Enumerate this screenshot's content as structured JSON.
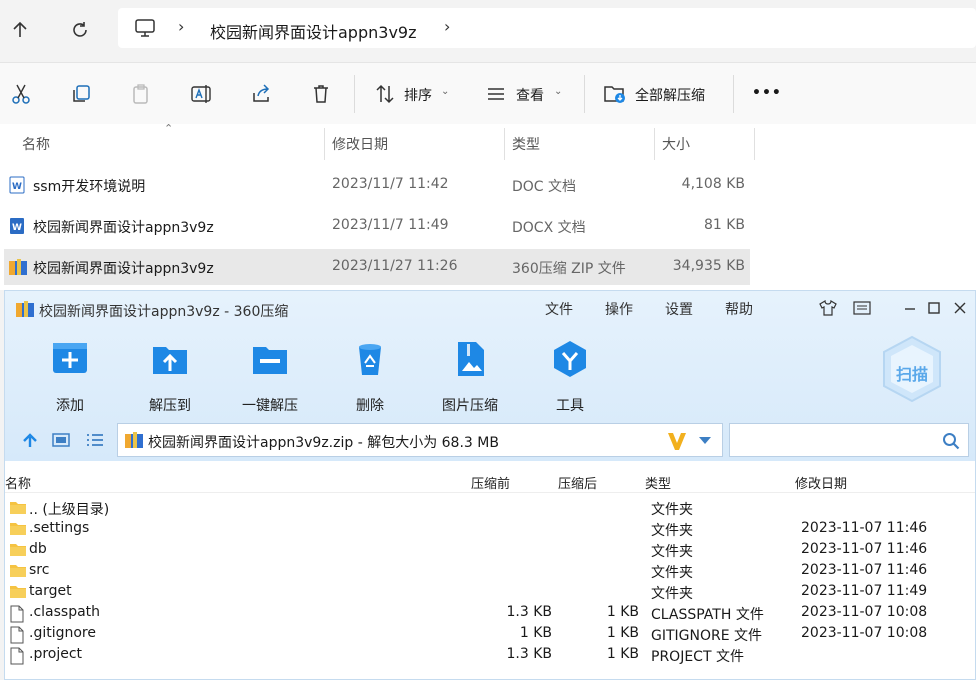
{
  "address": {
    "folder": "校园新闻界面设计appn3v9z"
  },
  "toolbar": {
    "sort_label": "排序",
    "view_label": "查看",
    "extract_all_label": "全部解压缩",
    "more_label": "•••"
  },
  "list": {
    "headers": {
      "name": "名称",
      "date": "修改日期",
      "type": "类型",
      "size": "大小"
    },
    "rows": [
      {
        "name": "ssm开发环境说明",
        "date": "2023/11/7 11:42",
        "type": "DOC 文档",
        "size": "4,108 KB"
      },
      {
        "name": "校园新闻界面设计appn3v9z",
        "date": "2023/11/7 11:49",
        "type": "DOCX 文档",
        "size": "81 KB"
      },
      {
        "name": "校园新闻界面设计appn3v9z",
        "date": "2023/11/27 11:26",
        "type": "360压缩 ZIP 文件",
        "size": "34,935 KB"
      }
    ]
  },
  "zip": {
    "title": "校园新闻界面设计appn3v9z - 360压缩",
    "menu": [
      "文件",
      "操作",
      "设置",
      "帮助"
    ],
    "buttons": [
      "添加",
      "解压到",
      "一键解压",
      "删除",
      "图片压缩",
      "工具"
    ],
    "scan_label": "扫描",
    "path": "校园新闻界面设计appn3v9z.zip - 解包大小为 68.3 MB",
    "headers": {
      "name": "名称",
      "before": "压缩前",
      "after": "压缩后",
      "type": "类型",
      "date": "修改日期"
    },
    "files": [
      {
        "name": ".. (上级目录)",
        "before": "",
        "after": "",
        "type": "文件夹",
        "date": "",
        "icon": "folder"
      },
      {
        "name": ".settings",
        "before": "",
        "after": "",
        "type": "文件夹",
        "date": "2023-11-07 11:46",
        "icon": "folder"
      },
      {
        "name": "db",
        "before": "",
        "after": "",
        "type": "文件夹",
        "date": "2023-11-07 11:46",
        "icon": "folder"
      },
      {
        "name": "src",
        "before": "",
        "after": "",
        "type": "文件夹",
        "date": "2023-11-07 11:46",
        "icon": "folder"
      },
      {
        "name": "target",
        "before": "",
        "after": "",
        "type": "文件夹",
        "date": "2023-11-07 11:49",
        "icon": "folder"
      },
      {
        "name": ".classpath",
        "before": "1.3 KB",
        "after": "1 KB",
        "type": "CLASSPATH 文件",
        "date": "2023-11-07 10:08",
        "icon": "file"
      },
      {
        "name": ".gitignore",
        "before": "1 KB",
        "after": "1 KB",
        "type": "GITIGNORE 文件",
        "date": "2023-11-07 10:08",
        "icon": "file"
      },
      {
        "name": ".project",
        "before": "1.3 KB",
        "after": "1 KB",
        "type": "PROJECT 文件",
        "date": "",
        "icon": "file"
      }
    ]
  },
  "colors": {
    "accent": "#1e88e5",
    "folder": "#f5c342",
    "zip_bg": "#e6f2fc"
  }
}
